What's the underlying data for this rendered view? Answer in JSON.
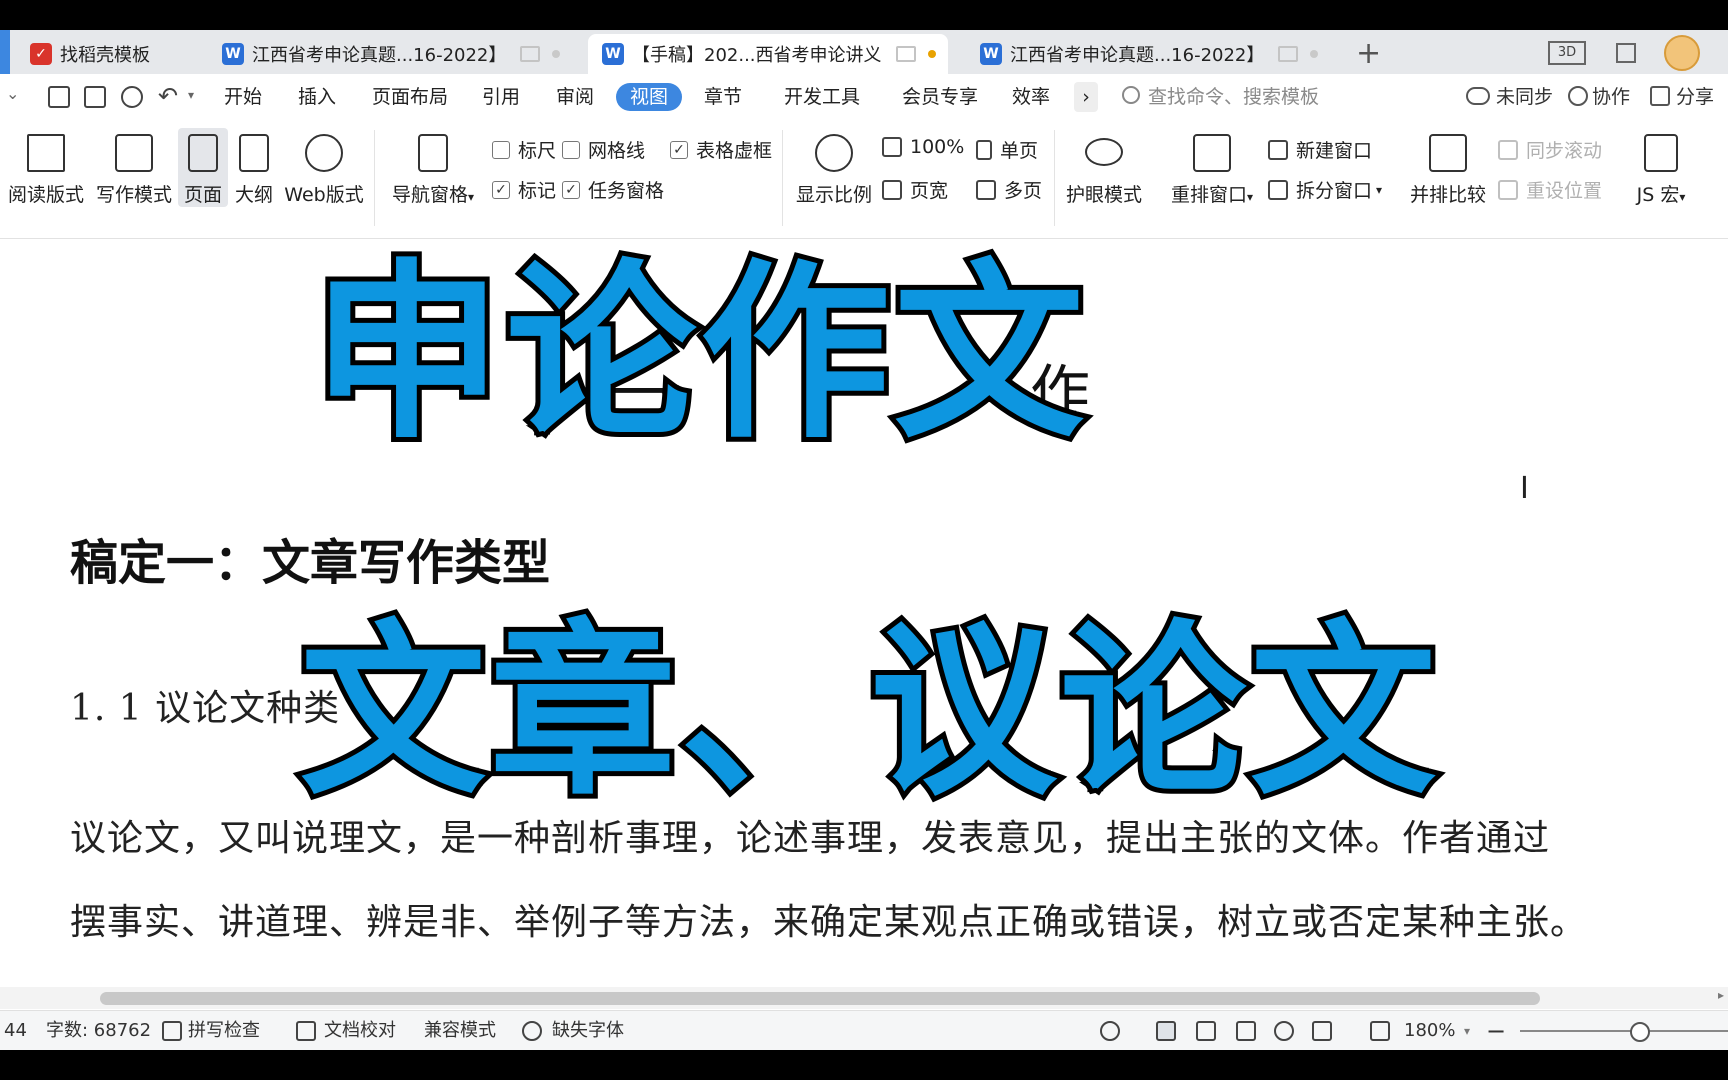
{
  "tabs": [
    {
      "label": "找稻壳模板",
      "color": "#d9342b"
    },
    {
      "label": "江西省考申论真题...16-2022】",
      "color": "#2b6fd6"
    },
    {
      "label": "【手稿】202...西省考申论讲义",
      "color": "#2b6fd6"
    },
    {
      "label": "江西省考申论真题...16-2022】",
      "color": "#2b6fd6"
    }
  ],
  "menu": [
    "开始",
    "插入",
    "页面布局",
    "引用",
    "审阅",
    "视图",
    "章节",
    "开发工具",
    "会员专享",
    "效率"
  ],
  "menu_more": "›",
  "search_placeholder": "查找命令、搜索模板",
  "right_actions": {
    "sync": "未同步",
    "collab": "协作",
    "share": "分享"
  },
  "ribbon": {
    "read_mode": "阅读版式",
    "write_mode": "写作模式",
    "page": "页面",
    "outline": "大纲",
    "web": "Web版式",
    "nav_pane": "导航窗格",
    "ruler": "标尺",
    "gridlines": "网格线",
    "table_border": "表格虚框",
    "mark": "标记",
    "task_pane": "任务窗格",
    "zoom_label": "显示比例",
    "zoom_100": "100%",
    "single_page": "单页",
    "page_width": "页宽",
    "multi_page": "多页",
    "eye_mode": "护眼模式",
    "rearrange": "重排窗口",
    "new_window": "新建窗口",
    "split_window": "拆分窗口",
    "side_by_side": "并排比较",
    "sync_scroll": "同步滚动",
    "reset_pos": "重设位置",
    "js_macro": "JS 宏",
    "icon_3d": "3D"
  },
  "document": {
    "ghost_title_a": "一",
    "ghost_title_b": "作",
    "section_heading": "稿定一：文章写作类型",
    "subheading": "1. 1 议论文种类",
    "para_line1": "议论文，又叫说理文，是一种剖析事理，论述事理，发表意见，提出主张的文体。作者通过",
    "para_line2": "摆事实、讲道理、辨是非、举例子等方法，来确定某观点正确或错误，树立或否定某种主张。"
  },
  "overlay": {
    "line1": "申论作文",
    "line2": "文章、议论文",
    "fill": "#0d96e0"
  },
  "status": {
    "page_num": "44",
    "word_count": "字数: 68762",
    "spell_check": "拼写检查",
    "doc_proof": "文档校对",
    "compat_mode": "兼容模式",
    "missing_font": "缺失字体",
    "zoom": "180%"
  }
}
